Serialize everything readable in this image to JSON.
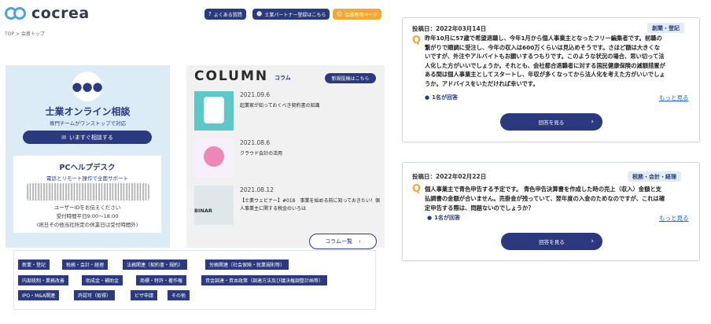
{
  "header": {
    "logo_text": "cocrea",
    "breadcrumb": "TOP > 会員トップ",
    "buttons": [
      {
        "label": "よくある質問",
        "icon": "question-circle-icon"
      },
      {
        "label": "士業パートナー登録はこちら",
        "icon": "user-plus-icon"
      },
      {
        "label": "会員専用ページ",
        "icon": "user-icon"
      }
    ],
    "colors": {
      "navy": "#2b3a7e",
      "orange": "#f4a732",
      "light_blue": "#dcecf7"
    }
  },
  "consult": {
    "icon": "people-icon",
    "title": "士業オンライン相談",
    "subtitle": "専門チームがワンストップで対応",
    "button": "いますぐ相談する",
    "help": {
      "title": "PCヘルプデスク",
      "line1": "電話とリモート操作で全面サポート",
      "user_id": "ユーザーIDをお伝えください",
      "hours": "受付時間平日9:00～18:00",
      "note": "(祝日その他当社所定の休業日は受付時間外)"
    }
  },
  "column": {
    "title": "COLUMN",
    "subtitle": "コラム",
    "new_post": "新規投稿はこちら",
    "items": [
      {
        "date": "2021.09.6",
        "text": "起業家が知っておくべき契約書の知識"
      },
      {
        "date": "2021.08.6",
        "text": "クラウド会計の活用"
      },
      {
        "date": "2021.08.12",
        "text": "【士業ウェビナー】#018　事業を始める前に知っておきたい！個人事業主に関する税金のいろは"
      }
    ],
    "thumb3_label": "BINAR",
    "list_button": "コラム一覧"
  },
  "tags": [
    [
      "新業・登記",
      "税務・会計・経理",
      "法務関連（契約書・規約）",
      "労務関連（社会保険・就業規則等）"
    ],
    [
      "内部統制・業務改善",
      "助成金・補助金",
      "商標・特許・著作権",
      "資金調達・資本政策（調達方法及び議決権調整計画等）"
    ],
    [
      "IPO・M&A関連",
      "許認可（取得）",
      "ビザ申請",
      "その他"
    ]
  ],
  "questions": [
    {
      "posted": "投稿日：2022年03月14日",
      "category": "創業・登記",
      "q_mark": "Q",
      "lines": [
        "昨年10月に57歳で希望退職し、今年1月から個人事業主となったフリー編集者です。前職の",
        "繋がりで順調に受注し、今年の収入は600万くらいは見込めそうです。さほど額は大きくな",
        "いですが、外注やアルバイトもお願いするつもりです。このような状況の場合、思い切って法",
        "人化した方がいいでしょうか。それとも、会社都合退職者に対する国民健康保険の減額措置が",
        "ある間は個人事業主としてスタートし、年収が多くなってから法人化を考えた方がいいでしょ",
        "うか。アドバイスをいただければ幸いです。"
      ],
      "answers": "1名が回答",
      "more": "もっと見る",
      "button": "回答を見る"
    },
    {
      "posted": "投稿日：2022年02月22日",
      "category": "税務・会計・経理",
      "q_mark": "Q",
      "lines": [
        "個人事業主で青色申告する予定です。 青色申告決算書を作成した時の売上（収入）金額と支",
        "払調書の金額が合いません。売掛金が残っていて、翌年度の入金のためなのですが、これは確",
        "定申告する際は、問題ないのでしょうか？"
      ],
      "answers": "1名が回答",
      "more": "もっと見る",
      "button": "回答を見る"
    }
  ]
}
